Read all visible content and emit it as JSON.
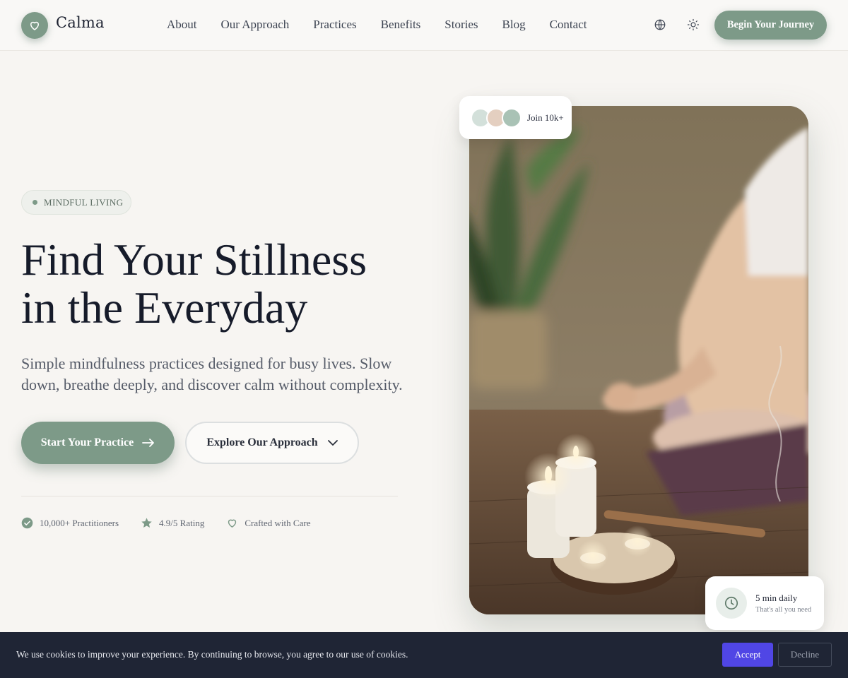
{
  "brand": {
    "name": "Calma",
    "icon": "heart-icon",
    "accent": "#7d9a88"
  },
  "nav": {
    "links": [
      "About",
      "Our Approach",
      "Practices",
      "Benefits",
      "Stories",
      "Blog",
      "Contact"
    ],
    "icons": [
      "globe-icon",
      "sun-icon"
    ],
    "cta": "Begin Your Journey"
  },
  "hero": {
    "badge": "MINDFUL LIVING",
    "headline_line1": "Find Your Stillness",
    "headline_line2": "in the Everyday",
    "subtext": "Simple mindfulness practices designed for busy lives. Slow down, breathe deeply, and discover calm without complexity.",
    "primary_button": "Start Your Practice",
    "secondary_button": "Explore Our Approach",
    "stats": [
      {
        "icon": "check-circle-icon",
        "label": "10,000+ Practitioners"
      },
      {
        "icon": "star-icon",
        "label": "4.9/5 Rating"
      },
      {
        "icon": "heart-outline-icon",
        "label": "Crafted with Care"
      }
    ]
  },
  "floating": {
    "join_text": "Join 10k+",
    "avatar_colors": [
      "#d3e0da",
      "#e4cfc0",
      "#a9c2b5"
    ],
    "time_title": "5 min daily",
    "time_sub": "That's all you need"
  },
  "cookie": {
    "message": "We use cookies to improve your experience. By continuing to browse, you agree to our use of cookies.",
    "accept": "Accept",
    "decline": "Decline",
    "accept_color": "#5046e5"
  }
}
